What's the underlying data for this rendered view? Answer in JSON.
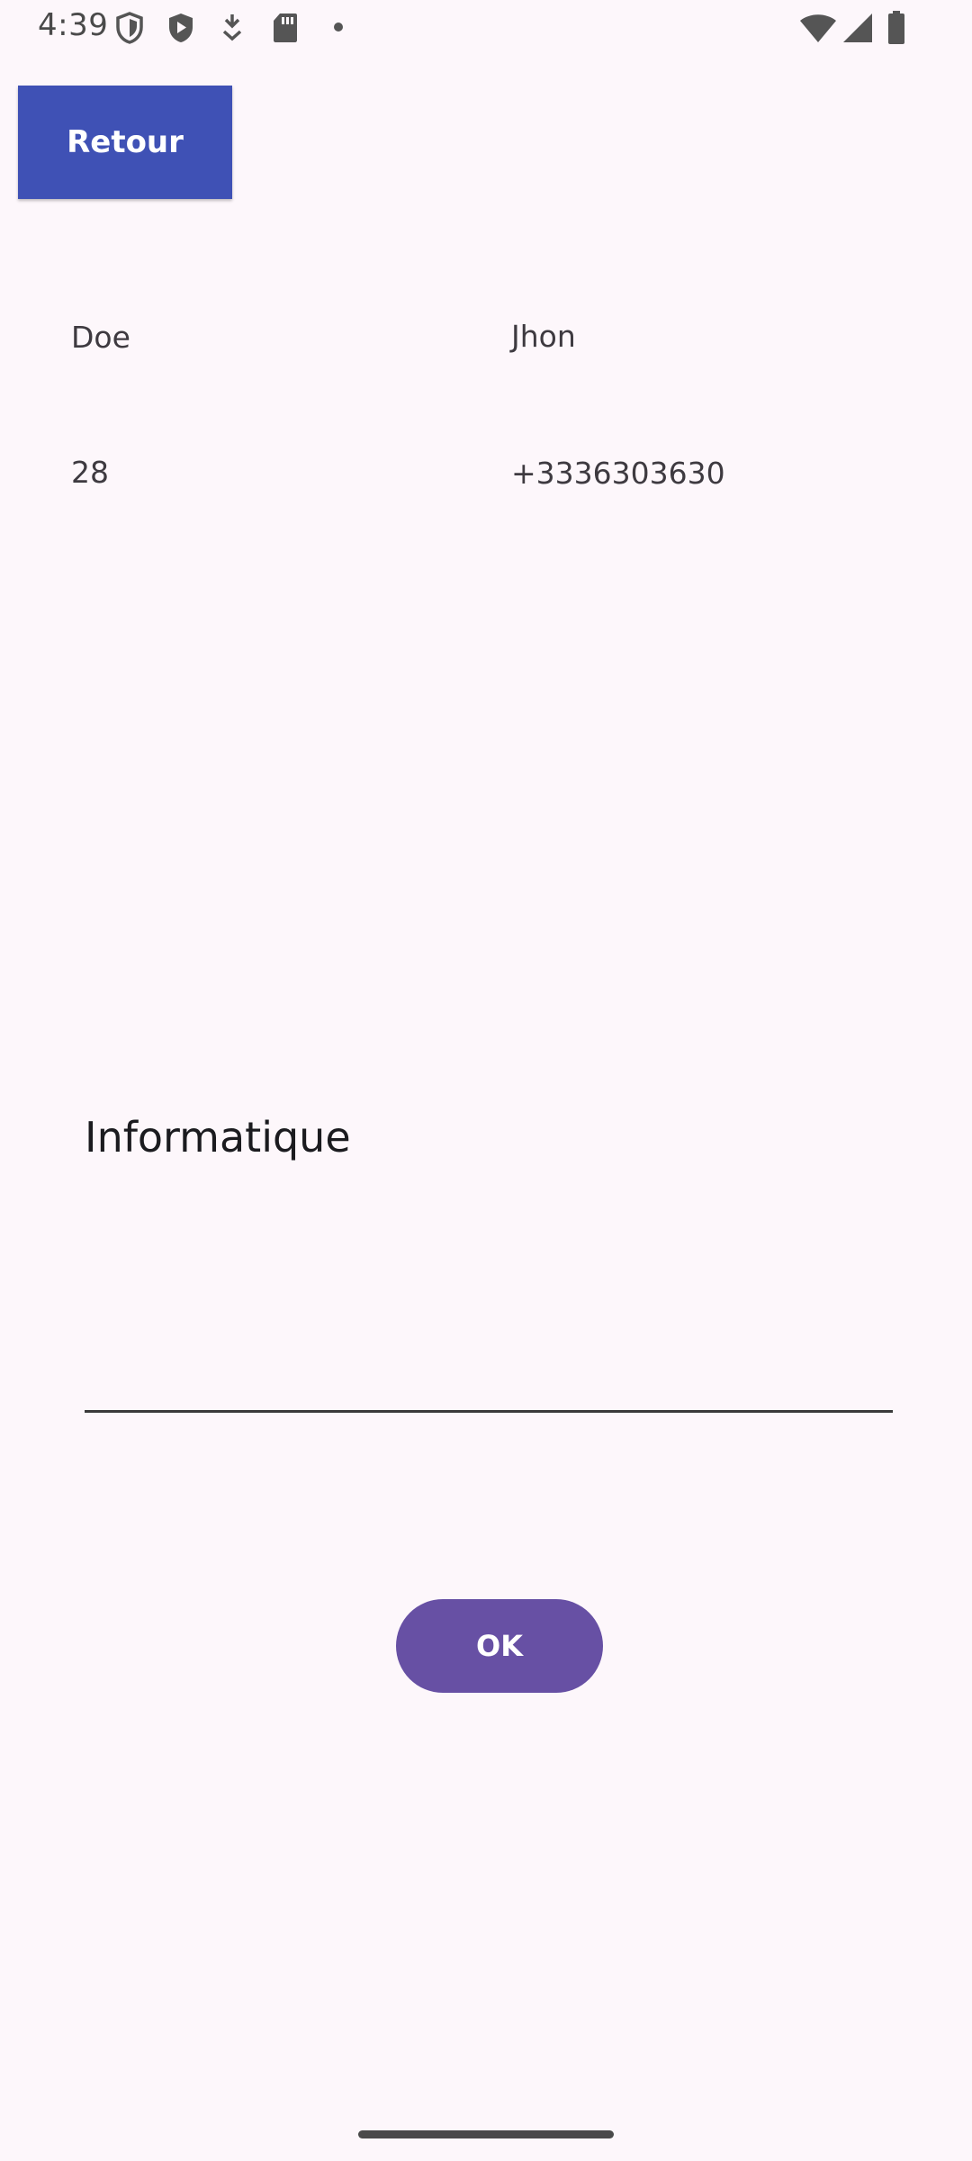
{
  "status_bar": {
    "time": "4:39",
    "left_icons": [
      "shield-outline-icon",
      "play-shield-icon",
      "download-icon",
      "sd-card-icon",
      "dot-icon"
    ],
    "right_icons": [
      "wifi-icon",
      "signal-icon",
      "battery-icon"
    ]
  },
  "toolbar": {
    "back_label": "Retour"
  },
  "profile": {
    "last_name": "Doe",
    "first_name": "Jhon",
    "age": "28",
    "phone": "+3336303630"
  },
  "department": {
    "label": "Informatique"
  },
  "actions": {
    "ok_label": "OK"
  },
  "colors": {
    "background": "#fdf7fb",
    "back_button": "#3f51b5",
    "ok_button": "#6750a4"
  }
}
